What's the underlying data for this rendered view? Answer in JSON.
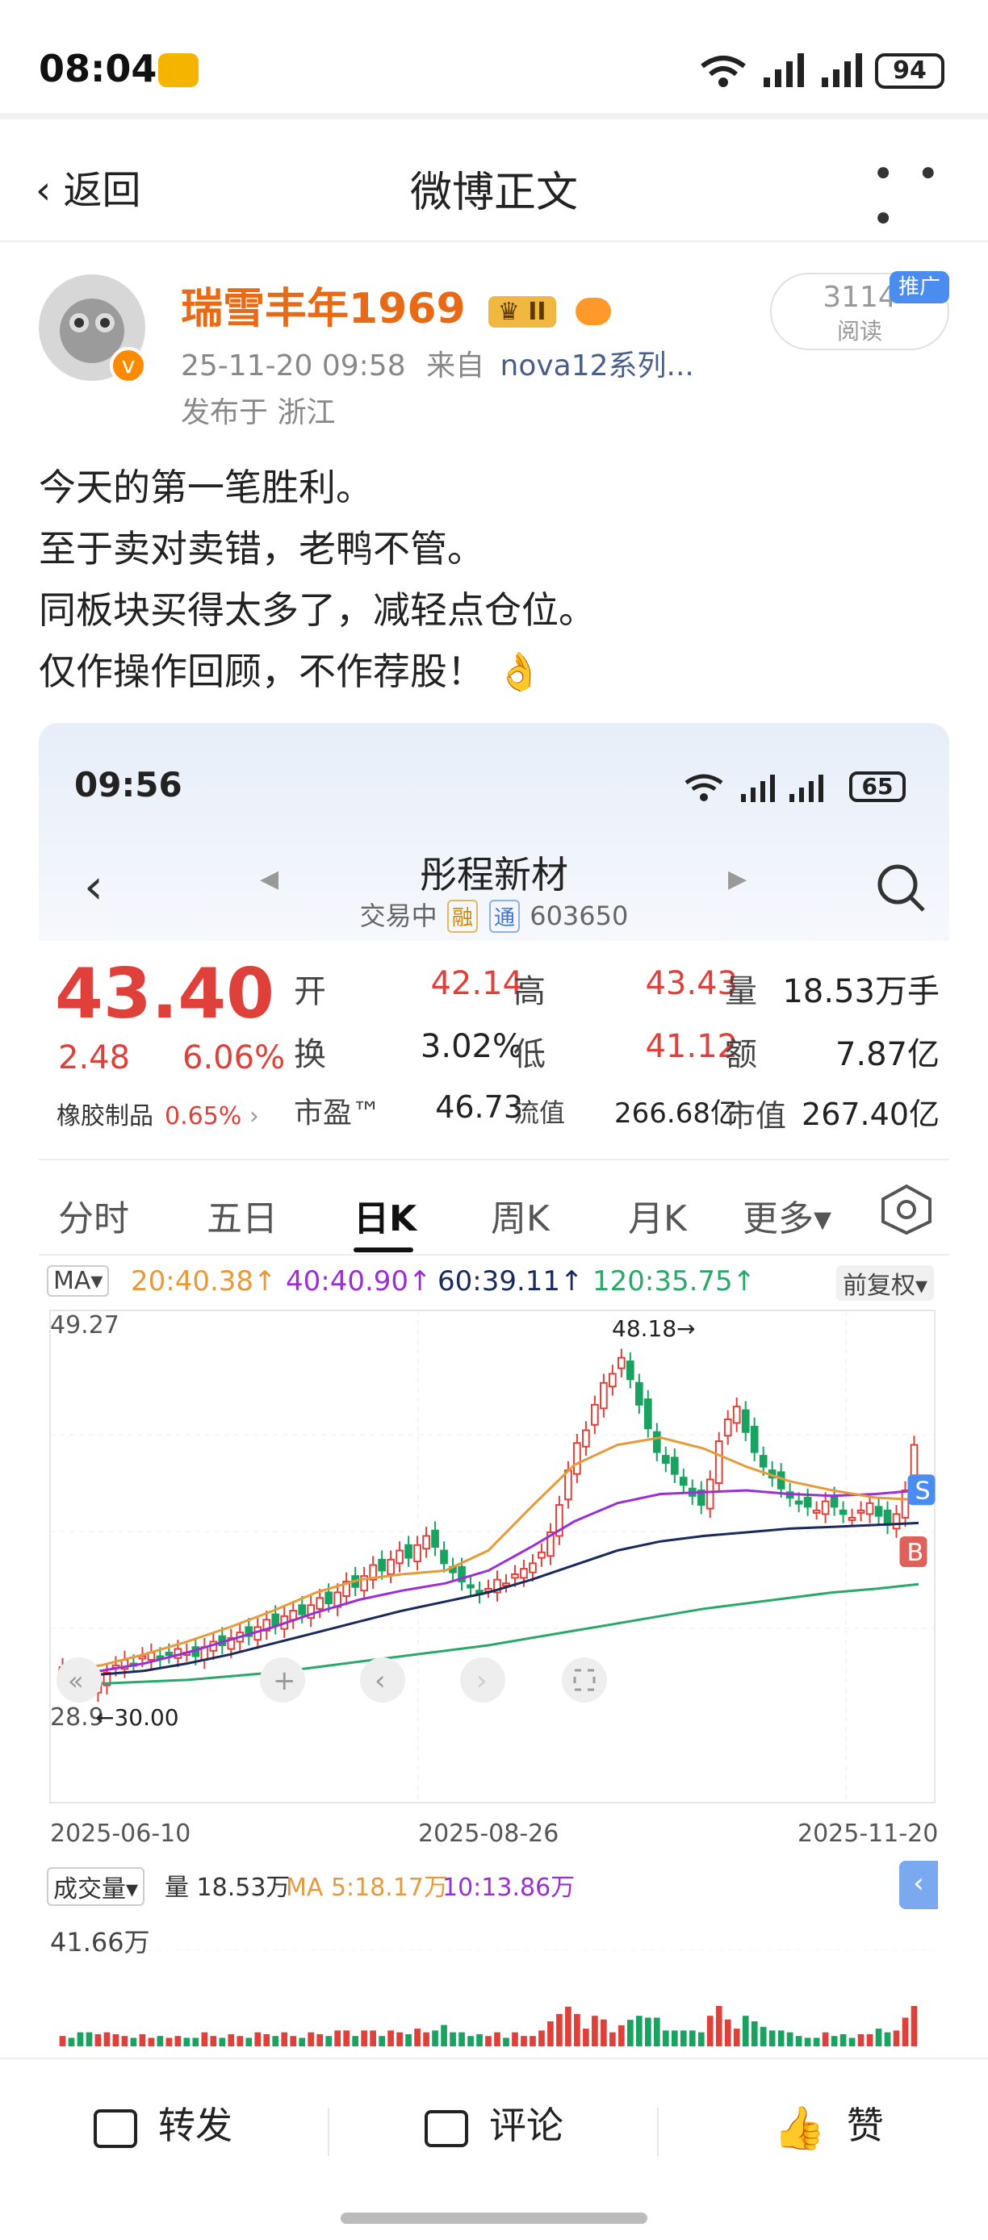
{
  "status": {
    "time": "08:04",
    "battery": "94"
  },
  "nav": {
    "back": "返回",
    "title": "微博正文",
    "more": "• • •"
  },
  "post": {
    "author": "瑞雪丰年1969",
    "level": "II",
    "timestamp": "25-11-20 09:58",
    "from_label": "来自",
    "device": "nova12系列...",
    "location": "发布于 浙江",
    "reads": "3114",
    "reads_label": "阅读",
    "promo": "推广",
    "text": "今天的第一笔胜利。\n至于卖对卖错，老鸭不管。\n同板块买得太多了，减轻点仓位。\n仅作操作回顾，不作荐股！ 👌"
  },
  "stock": {
    "time": "09:56",
    "battery": "65",
    "name": "彤程新材",
    "status": "交易中",
    "tag1": "融",
    "tag2": "通",
    "code": "603650",
    "price": "43.40",
    "change": "2.48",
    "change_pct": "6.06%",
    "sector": "橡胶制品",
    "sector_pct": "0.65%",
    "labels": {
      "open": "开",
      "high": "高",
      "volume": "量",
      "turnover": "换",
      "low": "低",
      "amount": "额",
      "pe": "市盈™",
      "float_cap": "流值",
      "mkt_cap": "市值"
    },
    "values": {
      "open": "42.14",
      "high": "43.43",
      "volume": "18.53万手",
      "turnover": "3.02%",
      "low": "41.12",
      "amount": "7.87亿",
      "pe": "46.73",
      "float_cap": "266.68亿",
      "mkt_cap": "267.40亿"
    },
    "tabs": [
      "分时",
      "五日",
      "日K",
      "周K",
      "月K",
      "更多▾"
    ],
    "ma_label": "MA▾",
    "ma": {
      "ma20": "20:40.38↑",
      "ma40": "40:40.90↑",
      "ma60": "60:39.11↑",
      "ma120": "120:35.75↑"
    },
    "adjust": "前复权▾",
    "vol_label": "成交量▾",
    "vol_value": "量 18.53万",
    "vol_ma5": "MA 5:18.17万",
    "vol_ma10": "10:13.86万",
    "vol_max": "41.66万"
  },
  "chart_data": {
    "type": "candlestick",
    "y_max_label": "49.27",
    "y_min_label": "28.9",
    "high_marker": "48.18→",
    "low_marker": "←30.00",
    "x_ticks": [
      "2025-06-10",
      "2025-08-26",
      "2025-11-20"
    ],
    "ylim": [
      28.9,
      49.27
    ],
    "close_series": [
      31.2,
      31.0,
      30.5,
      30.0,
      30.4,
      30.9,
      31.3,
      31.6,
      31.4,
      31.8,
      32.0,
      31.7,
      31.9,
      32.2,
      32.0,
      31.8,
      32.3,
      32.6,
      32.4,
      32.8,
      33.1,
      32.9,
      33.4,
      33.8,
      33.5,
      34.0,
      34.3,
      34.1,
      34.6,
      35.0,
      34.7,
      35.3,
      35.9,
      35.6,
      36.2,
      36.8,
      36.5,
      37.1,
      37.6,
      37.2,
      37.9,
      38.4,
      37.8,
      36.9,
      36.4,
      35.9,
      35.6,
      35.2,
      35.5,
      36.0,
      35.8,
      36.3,
      36.6,
      36.9,
      37.5,
      38.6,
      40.1,
      42.0,
      43.5,
      44.2,
      45.6,
      46.8,
      47.3,
      48.18,
      47.0,
      45.6,
      44.3,
      43.0,
      42.4,
      41.8,
      41.2,
      40.6,
      40.1,
      41.5,
      43.6,
      44.8,
      45.5,
      44.1,
      43.0,
      42.2,
      41.6,
      41.0,
      40.5,
      40.2,
      40.0,
      39.8,
      40.3,
      40.0,
      39.6,
      39.4,
      39.8,
      40.2,
      39.5,
      39.0,
      39.6,
      40.9,
      43.4
    ],
    "ma20": [
      31.0,
      31.3,
      31.9,
      32.6,
      33.4,
      34.3,
      35.3,
      36.0,
      36.3,
      36.5,
      37.6,
      40.0,
      42.3,
      43.4,
      43.8,
      43.2,
      42.2,
      41.4,
      40.9,
      40.5,
      40.38
    ],
    "ma40": [
      30.8,
      31.0,
      31.4,
      32.0,
      32.7,
      33.4,
      34.2,
      34.9,
      35.4,
      35.8,
      36.5,
      37.8,
      39.2,
      40.2,
      40.7,
      40.8,
      40.9,
      40.7,
      40.6,
      40.7,
      40.9
    ],
    "ma60": [
      30.6,
      30.8,
      31.0,
      31.4,
      31.9,
      32.5,
      33.1,
      33.7,
      34.3,
      34.8,
      35.3,
      36.0,
      36.8,
      37.6,
      38.1,
      38.4,
      38.6,
      38.8,
      38.9,
      39.0,
      39.11
    ],
    "ma120": [
      30.2,
      30.3,
      30.4,
      30.5,
      30.7,
      30.9,
      31.2,
      31.5,
      31.8,
      32.1,
      32.4,
      32.8,
      33.2,
      33.6,
      34.0,
      34.4,
      34.7,
      35.0,
      35.3,
      35.5,
      35.75
    ],
    "colors": {
      "up": "#e0403a",
      "down": "#1aa260",
      "ma20": "#e69a3a",
      "ma40": "#9a2fd6",
      "ma60": "#1b2a5c",
      "ma120": "#2aa86a"
    },
    "buy_marker": "B",
    "sell_marker": "S"
  },
  "bottom": {
    "repost": "转发",
    "comment": "评论",
    "like": "赞"
  }
}
